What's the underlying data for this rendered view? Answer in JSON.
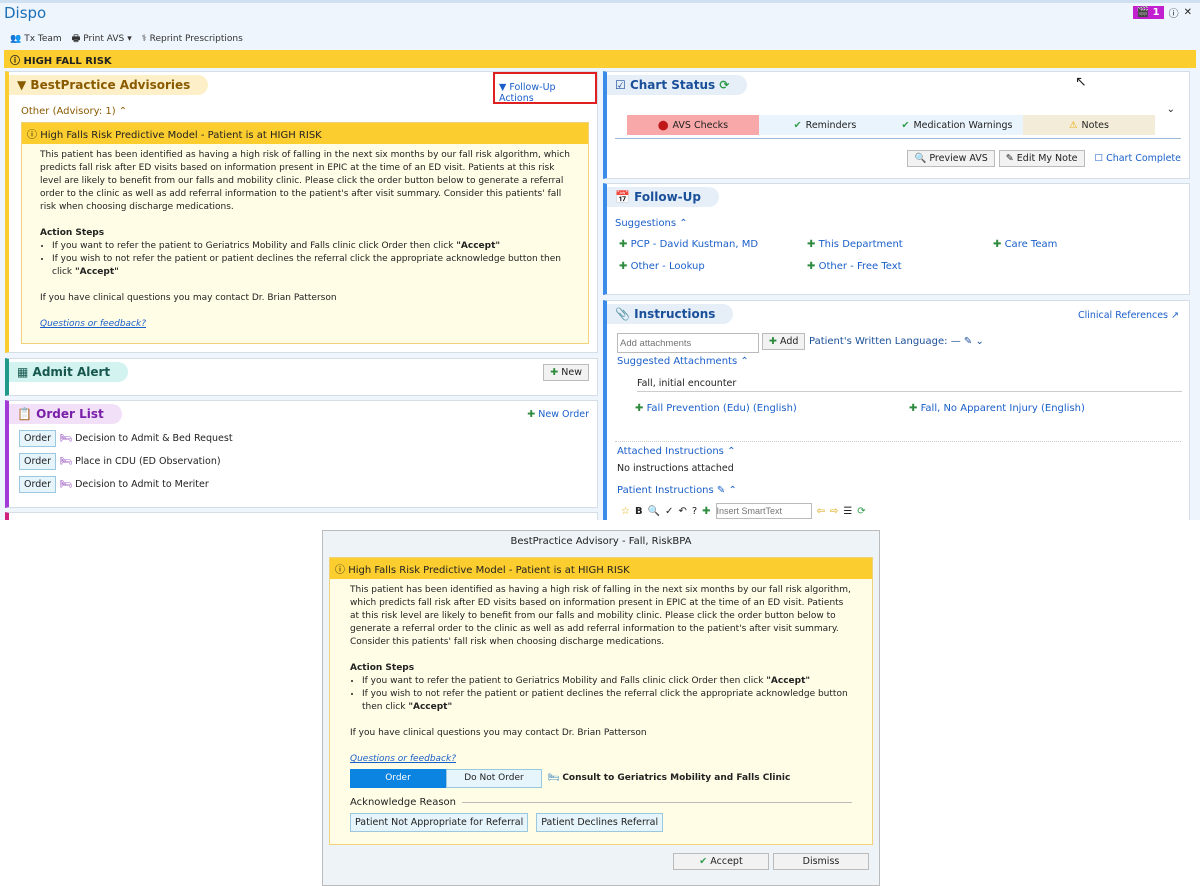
{
  "app": {
    "title": "Dispo",
    "badge_count": "1"
  },
  "toolbar": {
    "tx_team": "Tx Team",
    "print_avs": "Print AVS",
    "reprint": "Reprint Prescriptions"
  },
  "banner": "HIGH FALL RISK",
  "bpa": {
    "header": "BestPractice Advisories",
    "follow_up_actions": "Follow-Up Actions",
    "section": "Other (Advisory: 1)",
    "advisory_title": "High Falls Risk Predictive Model - Patient is at HIGH RISK",
    "body": "This patient has been identified as having a high risk of falling in the next six months by our fall risk algorithm, which predicts fall risk after ED visits based on information present in EPIC at the time of an ED visit.  Patients at this risk level are likely to benefit from our falls and mobility clinic.  Please click the order button below to generate a referral order to the clinic as well as add referral information to the patient's after visit summary.  Consider this patients' fall risk when choosing discharge medications.",
    "action_steps": "Action Steps",
    "step1": "If you want to refer the patient to Geriatrics Mobility and Falls clinic click Order then click ",
    "step1_bold": "\"Accept\"",
    "step2": "If you wish to not refer the patient or patient declines the referral click the appropriate acknowledge button then click ",
    "step2_bold": "\"Accept\"",
    "contact": "If you have clinical questions you may contact Dr. Brian Patterson",
    "feedback": "Questions or feedback?"
  },
  "admit_alert": {
    "header": "Admit Alert",
    "new": "New"
  },
  "order_list": {
    "header": "Order List",
    "new_order": "New Order",
    "order_label": "Order",
    "items": [
      "Decision to Admit & Bed Request",
      "Place in CDU (ED Observation)",
      "Decision to Admit to Meriter"
    ]
  },
  "chart_status": {
    "header": "Chart Status",
    "items": [
      {
        "label": "AVS Checks",
        "color": "#f8a8a8"
      },
      {
        "label": "Reminders",
        "color": "#eaf4fc"
      },
      {
        "label": "Medication Warnings",
        "color": "#eaf4fc"
      },
      {
        "label": "Notes",
        "color": "#f3ecd8"
      }
    ],
    "preview_avs": "Preview AVS",
    "edit_note": "Edit My Note",
    "chart_complete": "Chart Complete"
  },
  "follow_up": {
    "header": "Follow-Up",
    "suggestions": "Suggestions",
    "items": [
      "PCP - David Kustman, MD",
      "This Department",
      "Care Team",
      "Other - Lookup",
      "Other - Free Text"
    ]
  },
  "instructions": {
    "header": "Instructions",
    "clinical_refs": "Clinical References",
    "attach_placeholder": "Add attachments",
    "add": "Add",
    "written_language": "Patient's Written Language: —",
    "suggested": "Suggested Attachments",
    "diagnosis": "Fall, initial encounter",
    "att1": "Fall Prevention (Edu) (English)",
    "att2": "Fall, No Apparent Injury (English)",
    "attached": "Attached Instructions",
    "none": "No instructions attached",
    "patient_instructions": "Patient Instructions",
    "smarttext_placeholder": "Insert SmartText"
  },
  "dialog": {
    "title": "BestPractice Advisory - Fall, RiskBPA",
    "order": "Order",
    "do_not_order": "Do Not Order",
    "consult": "Consult to Geriatrics Mobility and Falls Clinic",
    "ack_reason": "Acknowledge Reason",
    "ack1": "Patient Not Appropriate for Referral",
    "ack2": "Patient Declines Referral",
    "accept": "Accept",
    "dismiss": "Dismiss"
  }
}
